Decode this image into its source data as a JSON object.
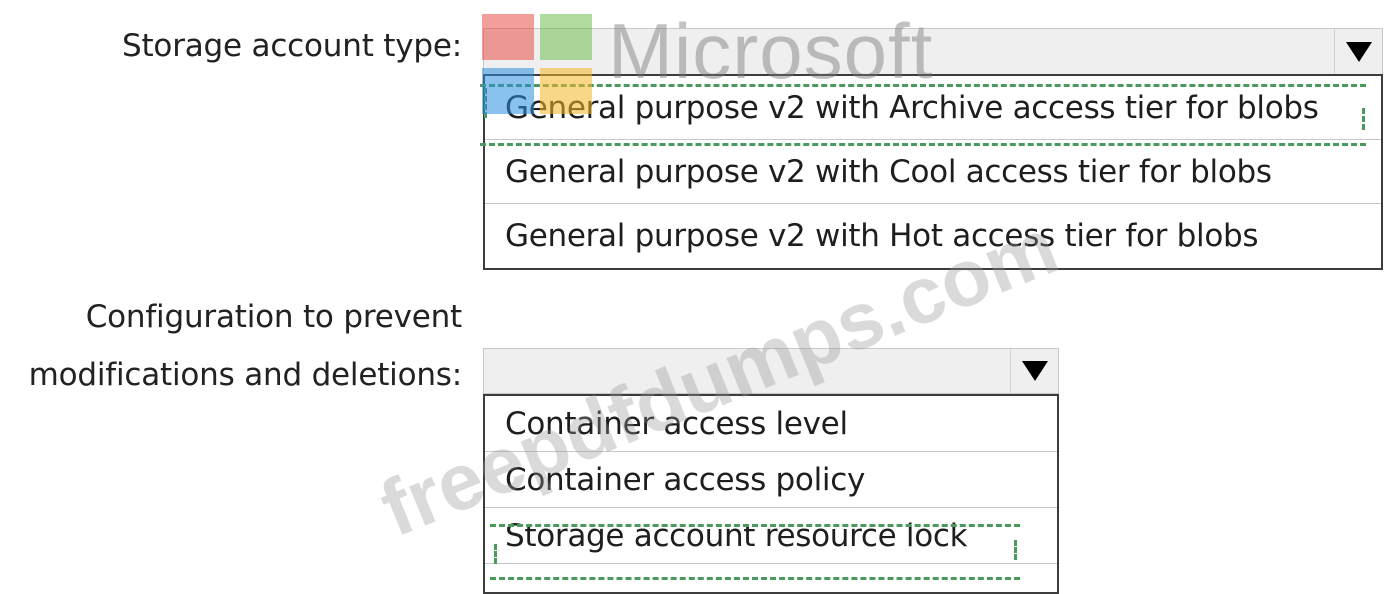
{
  "watermark": {
    "logo_text": "Microsoft",
    "site_text": "freepdfdumps.com"
  },
  "storage": {
    "label": "Storage account type:",
    "selected_value": "",
    "options": [
      "General purpose v2 with Archive access tier for blobs",
      "General purpose v2 with Cool access tier for blobs",
      "General purpose v2 with Hot access tier for blobs"
    ],
    "highlighted_option": "General purpose v2 with Archive access tier for blobs"
  },
  "config": {
    "label_line1": "Configuration to prevent",
    "label_line2": "modifications and deletions:",
    "selected_value": "",
    "options": [
      "Container access level",
      "Container access policy",
      "Storage account resource lock"
    ],
    "highlighted_option": "Storage account resource lock"
  },
  "colors": {
    "highlight_dash": "#4a9a5e",
    "dropdown_bg": "#efefef",
    "list_border": "#3c3c3c"
  },
  "icons": {
    "dropdown_arrow": "triangle-down-icon"
  }
}
